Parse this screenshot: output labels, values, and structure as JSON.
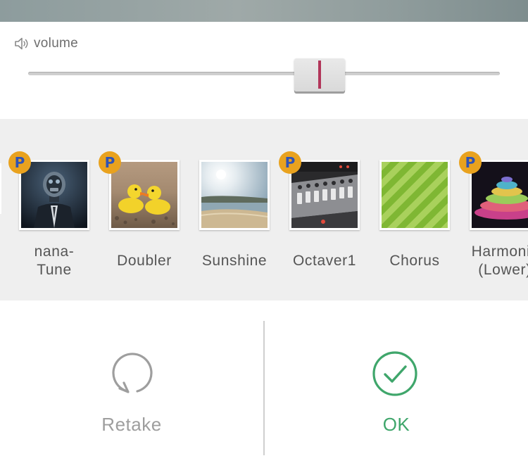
{
  "volume": {
    "label": "volume",
    "level_fraction": 0.63
  },
  "effects": [
    {
      "id": "nana-tune",
      "label_line1": "nana-",
      "label_line2": "Tune",
      "premium": true,
      "badge": "P"
    },
    {
      "id": "doubler",
      "label": "Doubler",
      "premium": true,
      "badge": "P"
    },
    {
      "id": "sunshine",
      "label": "Sunshine",
      "premium": false
    },
    {
      "id": "octaver1",
      "label": "Octaver1",
      "premium": true,
      "badge": "P"
    },
    {
      "id": "chorus",
      "label": "Chorus",
      "premium": false
    },
    {
      "id": "harmonizer-lower",
      "label_line1": "Harmoniz",
      "label_line2": "(Lower)",
      "premium": true,
      "badge": "P"
    }
  ],
  "actions": {
    "retake": {
      "label": "Retake",
      "icon": "refresh-icon",
      "color": "#9e9e9e"
    },
    "ok": {
      "label": "OK",
      "icon": "check-circle-icon",
      "color": "#3fa66b"
    }
  },
  "colors": {
    "slider_mark": "#b2365a",
    "badge_bg": "#e9a21e",
    "badge_fg": "#2f53b5"
  }
}
